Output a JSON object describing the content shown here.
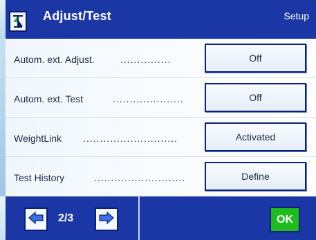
{
  "header": {
    "title": "Adjust/Test",
    "section": "Setup",
    "icon": "balance-icon"
  },
  "settings": [
    {
      "label": "Autom. ext. Adjust.",
      "dots": "...............",
      "value": "Off"
    },
    {
      "label": "Autom. ext. Test",
      "dots": ".....................",
      "value": "Off"
    },
    {
      "label": "WeightLink",
      "dots": "............................",
      "value": "Activated"
    },
    {
      "label": "Test History",
      "dots": "...........................",
      "value": "Define"
    }
  ],
  "footer": {
    "page": "2/3",
    "ok_label": "OK",
    "prev_icon": "left-arrow-icon",
    "next_icon": "right-arrow-icon"
  },
  "colors": {
    "header_bg": "#1b37a5",
    "ok_green": "#1fbb1f",
    "button_border": "#0b1f7a"
  }
}
